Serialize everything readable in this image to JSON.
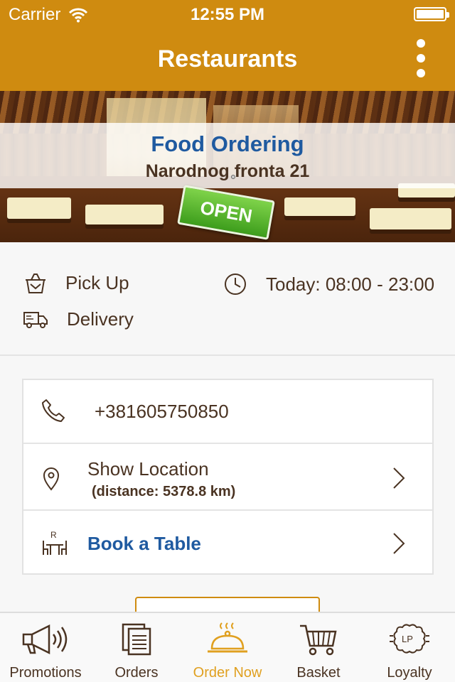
{
  "status": {
    "carrier": "Carrier",
    "time": "12:55 PM"
  },
  "header": {
    "title": "Restaurants",
    "menu_icon": "more-vertical-icon"
  },
  "banner": {
    "title": "Food Ordering",
    "address": "Narodnog fronta 21",
    "sign": "OPEN"
  },
  "info": {
    "pickup": "Pick Up",
    "delivery": "Delivery",
    "hours": "Today: 08:00 - 23:00"
  },
  "card": {
    "phone": "+381605750850",
    "location_label": "Show Location",
    "location_distance": "(distance: 5378.8 km)",
    "book_label": "Book a Table"
  },
  "tabs": [
    {
      "label": "Promotions",
      "icon": "megaphone-icon",
      "active": false
    },
    {
      "label": "Orders",
      "icon": "documents-icon",
      "active": false
    },
    {
      "label": "Order Now",
      "icon": "cloche-icon",
      "active": true
    },
    {
      "label": "Basket",
      "icon": "cart-icon",
      "active": false
    },
    {
      "label": "Loyalty",
      "icon": "loyalty-badge-icon",
      "active": false
    }
  ],
  "colors": {
    "header": "#cf8b10",
    "accent_blue": "#1f5aa0",
    "text_brown": "#4a3322",
    "active_tab": "#e0a020",
    "open_green": "#4fb526"
  }
}
